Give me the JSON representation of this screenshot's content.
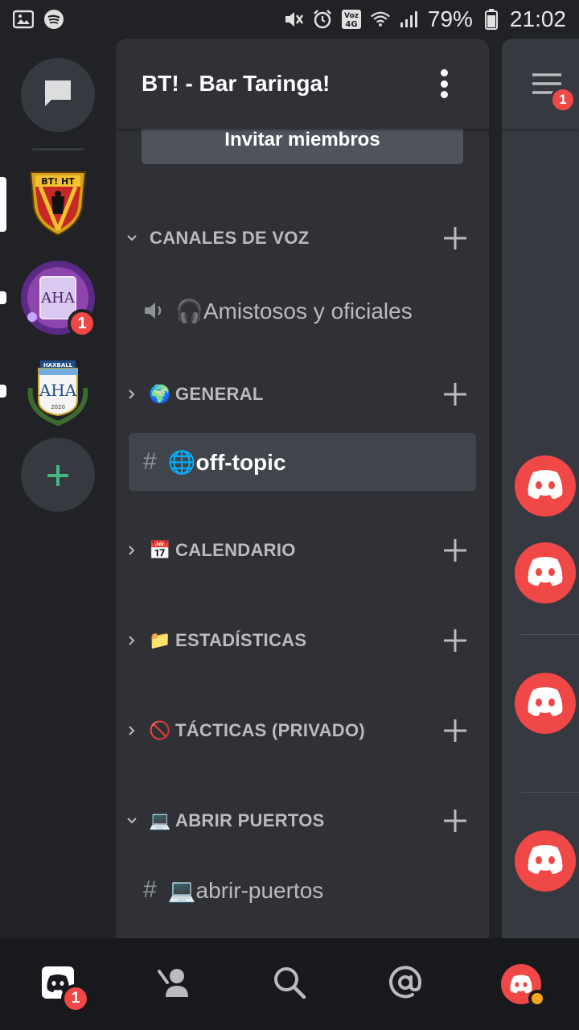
{
  "status_bar": {
    "battery": "79%",
    "time": "21:02",
    "network": "Voz 4G"
  },
  "server_rail": {
    "servers": [
      {
        "name": "BT! HT",
        "selected": true,
        "badge": ""
      },
      {
        "name": "AHA",
        "selected": false,
        "badge": "1"
      },
      {
        "name": "HAXBALL AHA 2020",
        "selected": false,
        "badge": ""
      }
    ]
  },
  "server": {
    "title": "BT! - Bar Taringa!",
    "invite_label": "Invitar miembros"
  },
  "categories": [
    {
      "label": "CANALES DE VOZ",
      "emoji": "",
      "expanded": true
    },
    {
      "label": "GENERAL",
      "emoji": "🌍",
      "expanded": false
    },
    {
      "label": "CALENDARIO",
      "emoji": "📅",
      "expanded": false
    },
    {
      "label": "ESTADÍSTICAS",
      "emoji": "📁",
      "expanded": false
    },
    {
      "label": "TÁCTICAS (PRIVADO)",
      "emoji": "🚫",
      "expanded": false
    },
    {
      "label": "ABRIR PUERTOS",
      "emoji": "💻",
      "expanded": true
    }
  ],
  "channels": [
    {
      "name": "🎧Amistosos y oficiales",
      "type": "voice"
    },
    {
      "name": "🌐off-topic",
      "type": "text",
      "active": true
    },
    {
      "name": "💻abrir-puertos",
      "type": "text"
    }
  ],
  "peek": {
    "badge": "1"
  },
  "bottom_nav": {
    "home_badge": "1"
  },
  "colors": {
    "accent_red": "#f04747",
    "add_green": "#43b581",
    "panel_bg": "#2f3136",
    "rail_bg": "#202225"
  }
}
